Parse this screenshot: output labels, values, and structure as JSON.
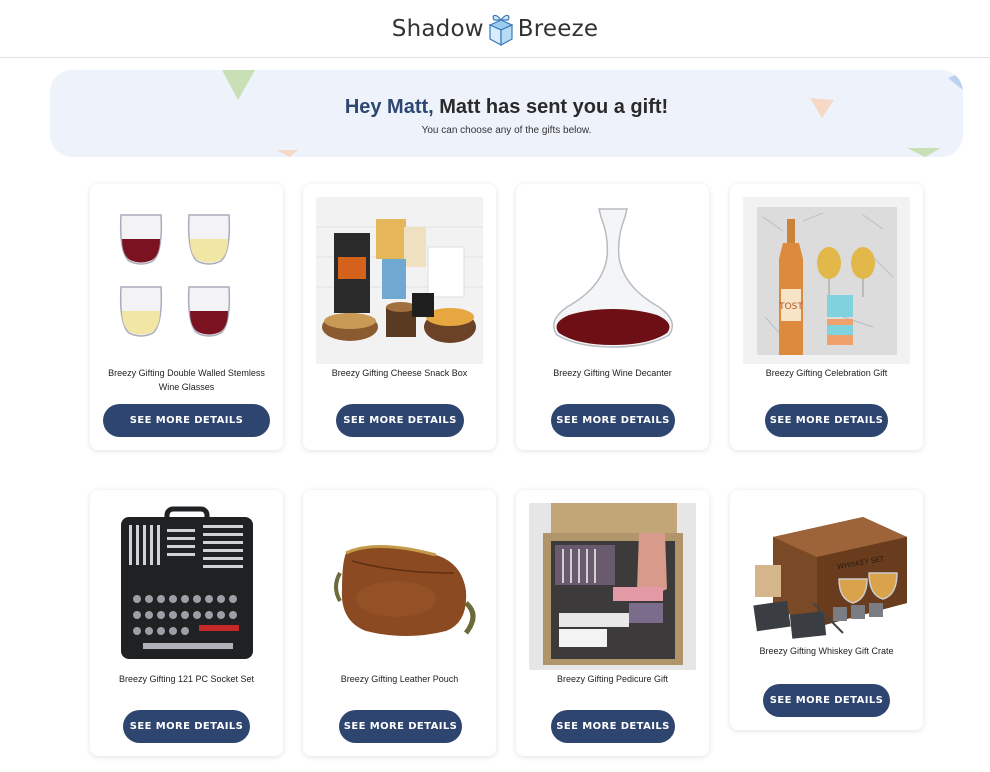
{
  "brand": {
    "left": "Shadow",
    "right": "Breeze",
    "icon": "gift-box-icon"
  },
  "banner": {
    "greeting": "Hey Matt,",
    "headline": " Matt has sent you a gift!",
    "subtext": "You can choose any of the gifts below."
  },
  "gifts": [
    {
      "name": "Breezy Gifting Double Walled Stemless Wine Glasses",
      "button": "SEE MORE DETAILS",
      "image": "wine-glasses-image"
    },
    {
      "name": "Breezy Gifting Cheese Snack Box",
      "button": "SEE MORE DETAILS",
      "image": "cheese-snack-box-image"
    },
    {
      "name": "Breezy Gifting Wine Decanter",
      "button": "SEE MORE DETAILS",
      "image": "wine-decanter-image"
    },
    {
      "name": "Breezy Gifting Celebration Gift",
      "button": "SEE MORE DETAILS",
      "image": "celebration-gift-image",
      "bottle_label": "TOST"
    },
    {
      "name": "Breezy Gifting 121 PC Socket Set",
      "button": "SEE MORE DETAILS",
      "image": "socket-set-image"
    },
    {
      "name": "Breezy Gifting Leather Pouch",
      "button": "SEE MORE DETAILS",
      "image": "leather-pouch-image"
    },
    {
      "name": "Breezy Gifting Pedicure Gift",
      "button": "SEE MORE DETAILS",
      "image": "pedicure-gift-image"
    },
    {
      "name": "Breezy Gifting Whiskey Gift Crate",
      "button": "SEE MORE DETAILS",
      "image": "whiskey-gift-crate-image",
      "crate_label": "WHISKEY SET"
    }
  ],
  "colors": {
    "button": "#2e4570",
    "banner_bg": "#eef3fb",
    "greeting": "#2c4770"
  }
}
